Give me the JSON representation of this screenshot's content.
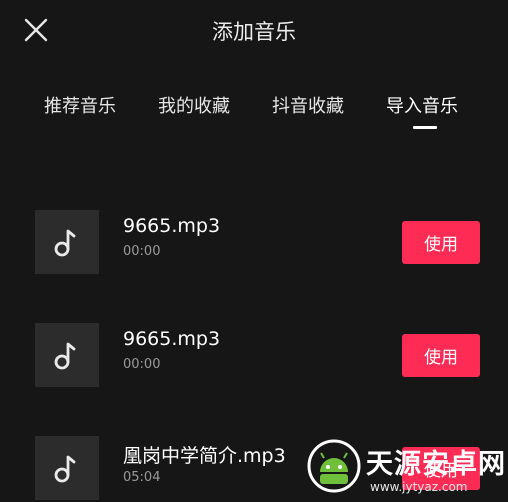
{
  "header": {
    "title": "添加音乐",
    "close_icon": "close-icon"
  },
  "tabs": [
    {
      "label": "推荐音乐",
      "active": false
    },
    {
      "label": "我的收藏",
      "active": false
    },
    {
      "label": "抖音收藏",
      "active": false
    },
    {
      "label": "导入音乐",
      "active": true
    }
  ],
  "songs": [
    {
      "name": "9665.mp3",
      "duration": "00:00",
      "use_label": "使用",
      "icon": "music-note-icon"
    },
    {
      "name": "9665.mp3",
      "duration": "00:00",
      "use_label": "使用",
      "icon": "music-note-icon"
    },
    {
      "name": "凰岗中学简介.mp3",
      "duration": "05:04",
      "use_label": "使用",
      "icon": "music-note-icon"
    }
  ],
  "watermark": {
    "name": "天源安卓网",
    "url": "www.jytyaz.com"
  },
  "colors": {
    "background": "#161616",
    "accent": "#fe2c55",
    "cover": "#2c2c2c",
    "duration_text": "#9a9a9a"
  }
}
